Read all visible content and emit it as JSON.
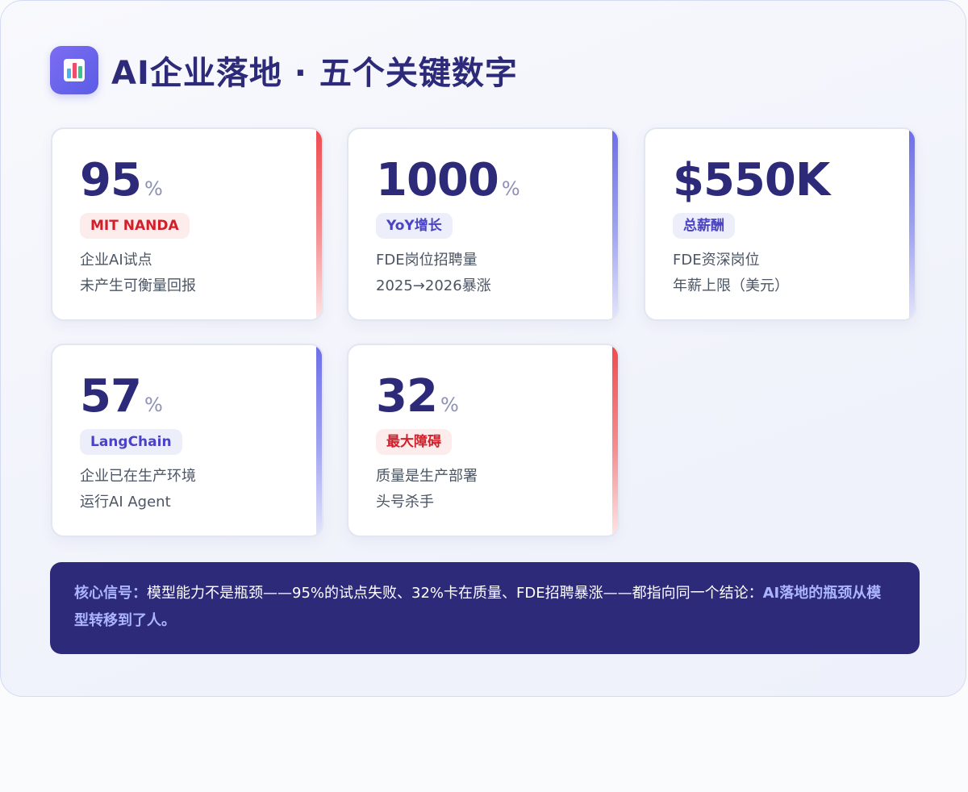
{
  "header": {
    "logo_icon": "bar-chart-icon",
    "title": "AI企业落地 · 五个关键数字"
  },
  "colors": {
    "title": "#2e2a7a",
    "accent_red": "#ee4b4f",
    "accent_blue": "#6c6ee8",
    "banner_bg": "#2e2a7a",
    "banner_highlight": "#aab4ff"
  },
  "cards": [
    {
      "value": "95",
      "unit": "%",
      "tag": "MIT NANDA",
      "tag_color": "red",
      "desc1": "企业AI试点",
      "desc2": "未产生可衡量回报"
    },
    {
      "value": "1000",
      "unit": "%",
      "tag": "YoY增长",
      "tag_color": "blue",
      "desc1": "FDE岗位招聘量",
      "desc2": "2025→2026暴涨"
    },
    {
      "value": "$550K",
      "unit": "",
      "tag": "总薪酬",
      "tag_color": "blue",
      "desc1": "FDE资深岗位",
      "desc2": "年薪上限（美元）"
    },
    {
      "value": "57",
      "unit": "%",
      "tag": "LangChain",
      "tag_color": "blue",
      "desc1": "企业已在生产环境",
      "desc2": "运行AI Agent"
    },
    {
      "value": "32",
      "unit": "%",
      "tag": "最大障碍",
      "tag_color": "red",
      "desc1": "质量是生产部署",
      "desc2": "头号杀手"
    }
  ],
  "banner": {
    "label": "核心信号：",
    "text": "模型能力不是瓶颈——95%的试点失败、32%卡在质量、FDE招聘暴涨——都指向同一个结论：",
    "conclusion": "AI落地的瓶颈从模型转移到了人。"
  }
}
